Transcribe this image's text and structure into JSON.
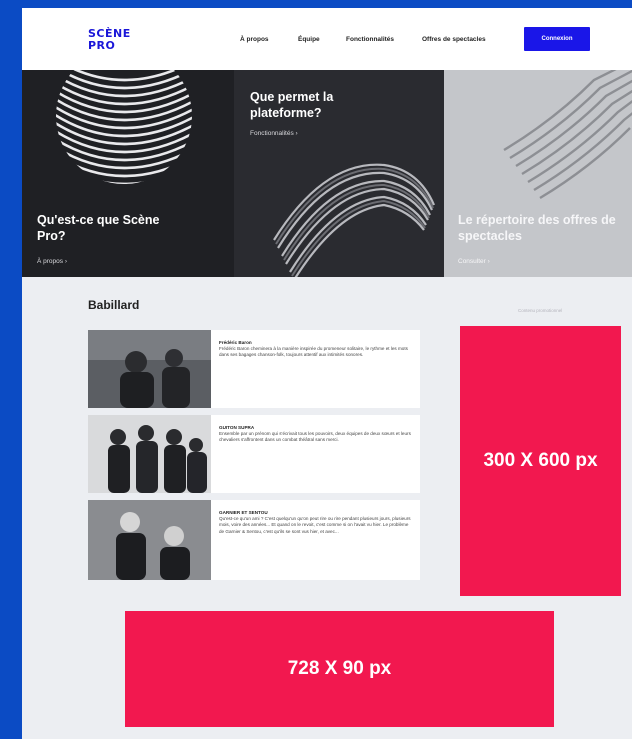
{
  "header": {
    "logo": "SCÈNE PRO",
    "nav": [
      "À propos",
      "Équipe",
      "Fonctionnalités",
      "Offres de spectacles"
    ],
    "connect_label": "Connexion"
  },
  "hero": {
    "panels": [
      {
        "title": "Qu'est-ce que Scène Pro?",
        "link": "À propos"
      },
      {
        "title": "Que permet la plateforme?",
        "link": "Fonctionnalités"
      },
      {
        "title": "Le répertoire des offres de spectacles",
        "link": "Consulter"
      }
    ]
  },
  "babillard": {
    "title": "Babillard",
    "promo_label": "Contenu promotionnel",
    "cards": [
      {
        "name": "Frédéric Baron",
        "text": "Frédéric Baron cheminera à la manière inspirée du promeneur solitaire, le rythme et les mots dans ses bagages chanson-folk, toujours attentif aux intimités sonores."
      },
      {
        "name": "GUITON SUPRA",
        "text": "Ensemble par un prénom qui s'écrivait tous les pouvoirs, deux équipes de deux sœurs et leurs chevaliers s'affrontent dans un combat théâtral sans merci."
      },
      {
        "name": "GARNIER ET SENTOU",
        "text": "Qu'est-ce qu'un ami ? C'est quelqu'un qu'on peut rire ou rire pendant plusieurs jours, plusieurs mois, voire des années... Et quand on le revoit, c'est comme si on l'avait vu hier. Le problème de Garnier & Sentou, c'est qu'ils se sont vus hier, et avec..."
      }
    ]
  },
  "ads": {
    "side": "300 X 600 px",
    "banner": "728 X 90 px"
  },
  "colors": {
    "frame": "#0b4bc4",
    "accent": "#1a16e8",
    "ad": "#f2184f"
  }
}
